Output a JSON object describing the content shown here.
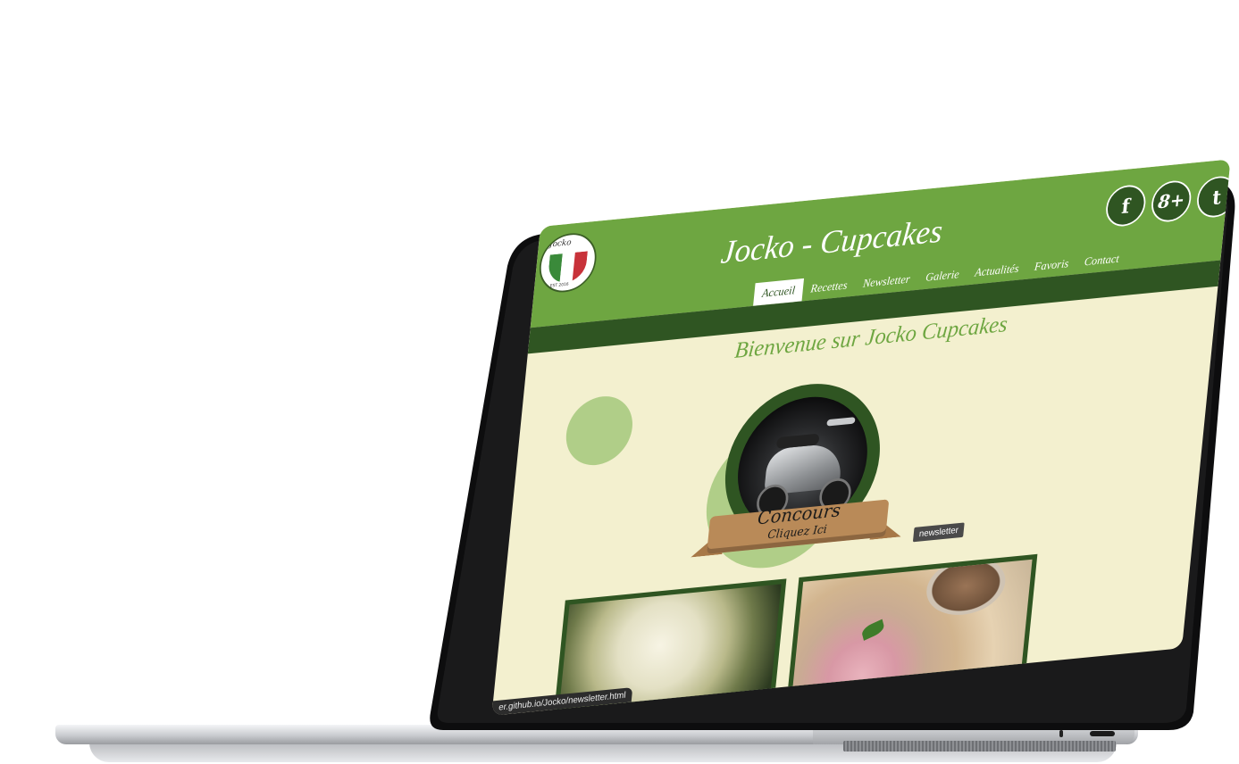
{
  "site": {
    "title": "Jocko - Cupcakes",
    "logo_text": "Jocko",
    "logo_est": "EST 2016",
    "welcome": "Bienvenue sur Jocko Cupcakes"
  },
  "social": [
    {
      "icon": "facebook-icon",
      "glyph": "f"
    },
    {
      "icon": "google-plus-icon",
      "glyph": "8+"
    },
    {
      "icon": "twitter-icon",
      "glyph": "t"
    }
  ],
  "nav": {
    "items": [
      "Accueil",
      "Recettes",
      "Newsletter",
      "Galerie",
      "Actualités",
      "Favoris",
      "Contact"
    ],
    "active": "Accueil"
  },
  "banner": {
    "line1": "Concours",
    "line2": "Cliquez Ici"
  },
  "tooltip": "newsletter",
  "status_url": "er.github.io/Jocko/newsletter.html",
  "colors": {
    "header_green": "#6ea641",
    "dark_green": "#2f5522",
    "cream": "#f3f0cf",
    "light_green": "#b0ce88"
  }
}
